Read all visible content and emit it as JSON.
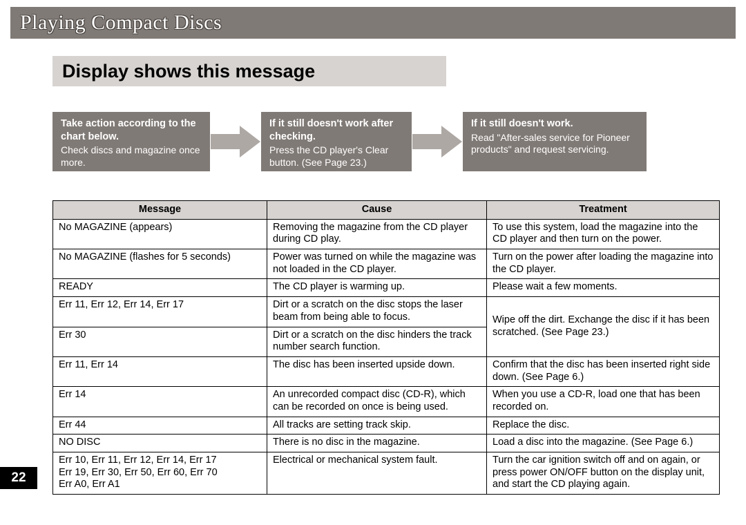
{
  "chapter_title": "Playing Compact Discs",
  "section_title": "Display shows this message",
  "steps": [
    {
      "head": "Take action according to the chart below.",
      "body": "Check discs and magazine once more."
    },
    {
      "head": "If it still doesn't work after checking.",
      "body": "Press the CD player's Clear button. (See Page 23.)"
    },
    {
      "head": "If it still doesn't work.",
      "body": "Read \"After-sales service for Pioneer products\" and request servicing."
    }
  ],
  "table": {
    "headers": [
      "Message",
      "Cause",
      "Treatment"
    ],
    "rows": [
      {
        "message": "No MAGAZINE (appears)",
        "cause": "Removing the magazine from the CD player during CD play.",
        "treatment": "To use this system, load the magazine into the CD player and then turn on the power."
      },
      {
        "message": "No MAGAZINE (flashes for 5 seconds)",
        "cause": "Power was turned on while the magazine was not loaded in the CD player.",
        "treatment": "Turn on the power after loading the magazine into the CD player."
      },
      {
        "message": "READY",
        "cause": "The CD player is warming up.",
        "treatment": "Please wait a few moments."
      },
      {
        "message": "Err 11, Err 12, Err 14, Err 17",
        "cause": "Dirt or a scratch on the disc stops the laser beam from being able to focus.",
        "treatment_span": true
      },
      {
        "message": "Err 30",
        "cause": "Dirt or a scratch on the disc hinders the track number search function.",
        "treatment_merge": "Wipe off the dirt. Exchange the disc if it has been scratched. (See Page 23.)"
      },
      {
        "message": "Err 11, Err 14",
        "cause": "The disc has been inserted upside down.",
        "treatment": "Confirm that the disc has been inserted right side down. (See Page 6.)"
      },
      {
        "message": "Err 14",
        "cause": "An unrecorded compact disc (CD-R), which can be recorded on once is being used.",
        "treatment": "When you use a CD-R, load one that has been recorded on."
      },
      {
        "message": "Err 44",
        "cause": "All tracks are setting track skip.",
        "treatment": "Replace the disc."
      },
      {
        "message": "NO DISC",
        "cause": "There is no disc in the magazine.",
        "treatment": "Load a disc into the magazine. (See Page 6.)"
      },
      {
        "message": "Err 10, Err 11, Err 12, Err 14, Err 17\nErr 19, Err 30, Err 50, Err 60, Err 70\nErr A0, Err A1",
        "cause": "Electrical or mechanical system fault.",
        "treatment": "Turn the car ignition switch off and on again, or press power ON/OFF button on the display unit, and start the CD playing again."
      }
    ]
  },
  "page_number": "22"
}
